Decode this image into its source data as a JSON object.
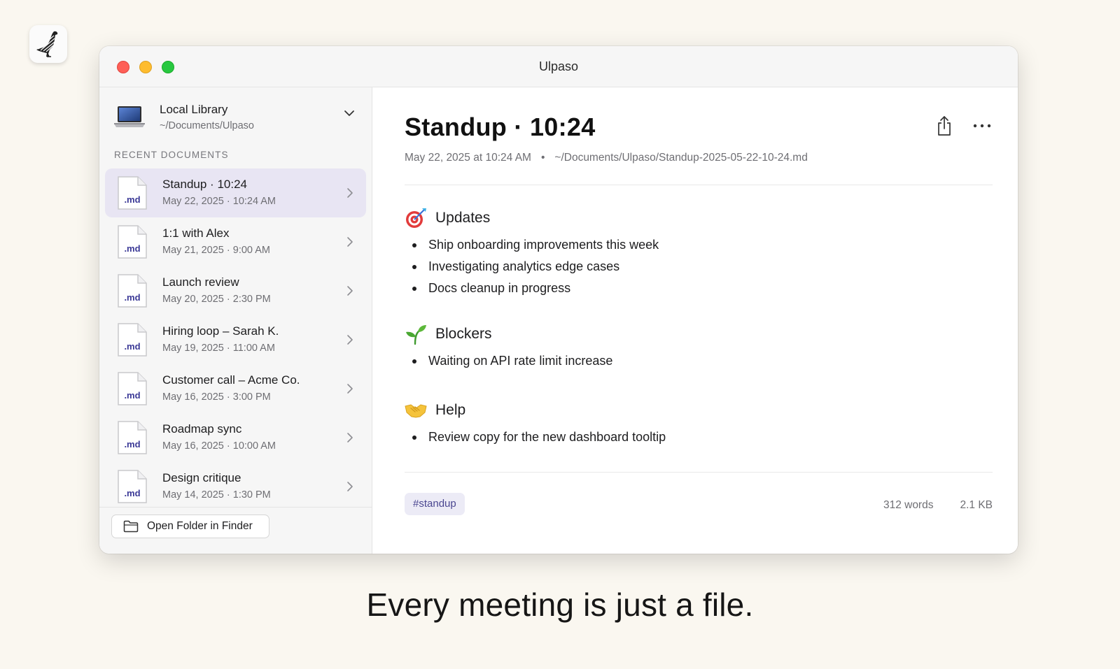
{
  "window": {
    "title": "Ulpaso"
  },
  "sidebar": {
    "library": {
      "name": "Local Library",
      "path": "~/Documents/Ulpaso",
      "icon": "laptop-icon"
    },
    "section_label": "RECENT DOCUMENTS",
    "file_badge": ".md",
    "documents": [
      {
        "title": "Standup · 10:24",
        "date": "May 22, 2025 · 10:24 AM",
        "selected": true
      },
      {
        "title": "1:1 with Alex",
        "date": "May 21, 2025 · 9:00 AM"
      },
      {
        "title": "Launch review",
        "date": "May 20, 2025 · 2:30 PM"
      },
      {
        "title": "Hiring loop – Sarah K.",
        "date": "May 19, 2025 · 11:00 AM"
      },
      {
        "title": "Customer call – Acme Co.",
        "date": "May 16, 2025 · 3:00 PM"
      },
      {
        "title": "Roadmap sync",
        "date": "May 16, 2025 · 10:00 AM"
      },
      {
        "title": "Design critique",
        "date": "May 14, 2025 · 1:30 PM"
      }
    ],
    "open_folder_label": "Open Folder in Finder"
  },
  "document": {
    "title": "Standup · 10:24",
    "created": "May 22, 2025 at 10:24 AM",
    "separator": "•",
    "path": "~/Documents/Ulpaso/Standup-2025-05-22-10-24.md",
    "sections": [
      {
        "icon": "target-icon",
        "heading": "Updates",
        "items": [
          "Ship onboarding improvements this week",
          "Investigating analytics edge cases",
          "Docs cleanup in progress"
        ]
      },
      {
        "icon": "seedling-icon",
        "heading": "Blockers",
        "items": [
          "Waiting on API rate limit increase"
        ]
      },
      {
        "icon": "handshake-icon",
        "heading": "Help",
        "items": [
          "Review copy for the new dashboard tooltip"
        ]
      }
    ],
    "tag": "#standup",
    "word_count": "312 words",
    "file_size": "2.1 KB"
  },
  "tagline": "Every meeting is just a file.",
  "colors": {
    "selection": "#e8e5f3",
    "tag_bg": "#ecebf6",
    "tag_text": "#4b4791",
    "badge_text": "#3a3896"
  }
}
